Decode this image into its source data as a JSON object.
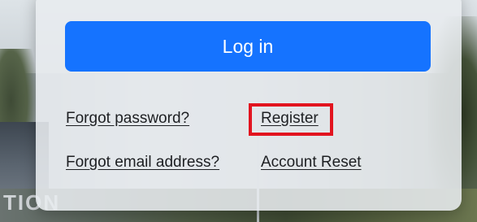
{
  "background": {
    "partial_text": "TION"
  },
  "login_form": {
    "login_button_label": "Log in",
    "links": {
      "forgot_password": "Forgot password?",
      "register": "Register",
      "forgot_email": "Forgot email address?",
      "account_reset": "Account Reset"
    }
  },
  "colors": {
    "primary_button": "#1573ff",
    "highlight": "#e2141f"
  }
}
